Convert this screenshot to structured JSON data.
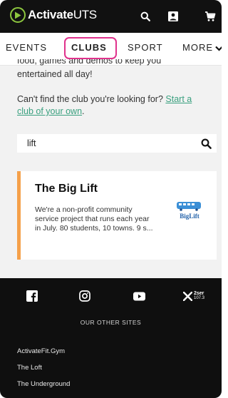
{
  "header": {
    "logo_bold": "Activate",
    "logo_light": "UTS",
    "icons": [
      "search-icon",
      "account-icon",
      "cart-icon"
    ]
  },
  "tabs": [
    {
      "label": "EVENTS"
    },
    {
      "label": "CLUBS",
      "active": true
    },
    {
      "label": "SPORT"
    },
    {
      "label": "MORE"
    }
  ],
  "intro": {
    "cut_text": "food, games and demos to keep you",
    "line2": "entertained all day!",
    "find_club_text": "Can't find the club you're looking for?",
    "start_link": "Start a club of your own",
    "after_link": "."
  },
  "search": {
    "value": "lift"
  },
  "result_card": {
    "title": "The Big Lift",
    "description": "We're a non-profit community service project that runs each year in July. 80 students, 10 towns. 9 s...",
    "logo_text": "BigLift",
    "accent_color": "#f5a04a"
  },
  "footer": {
    "social_icons": [
      "facebook-icon",
      "instagram-icon",
      "youtube-icon",
      "x-icon"
    ],
    "radio_badge_top": "2ser",
    "radio_badge_bottom": "107.3",
    "other_sites_heading": "OUR OTHER SITES",
    "links": [
      "ActivateFit.Gym",
      "The Loft",
      "The Underground"
    ]
  },
  "colors": {
    "brand_green": "#8dc63f",
    "highlight_pink": "#e0328c",
    "link_green": "#3aa07f"
  }
}
